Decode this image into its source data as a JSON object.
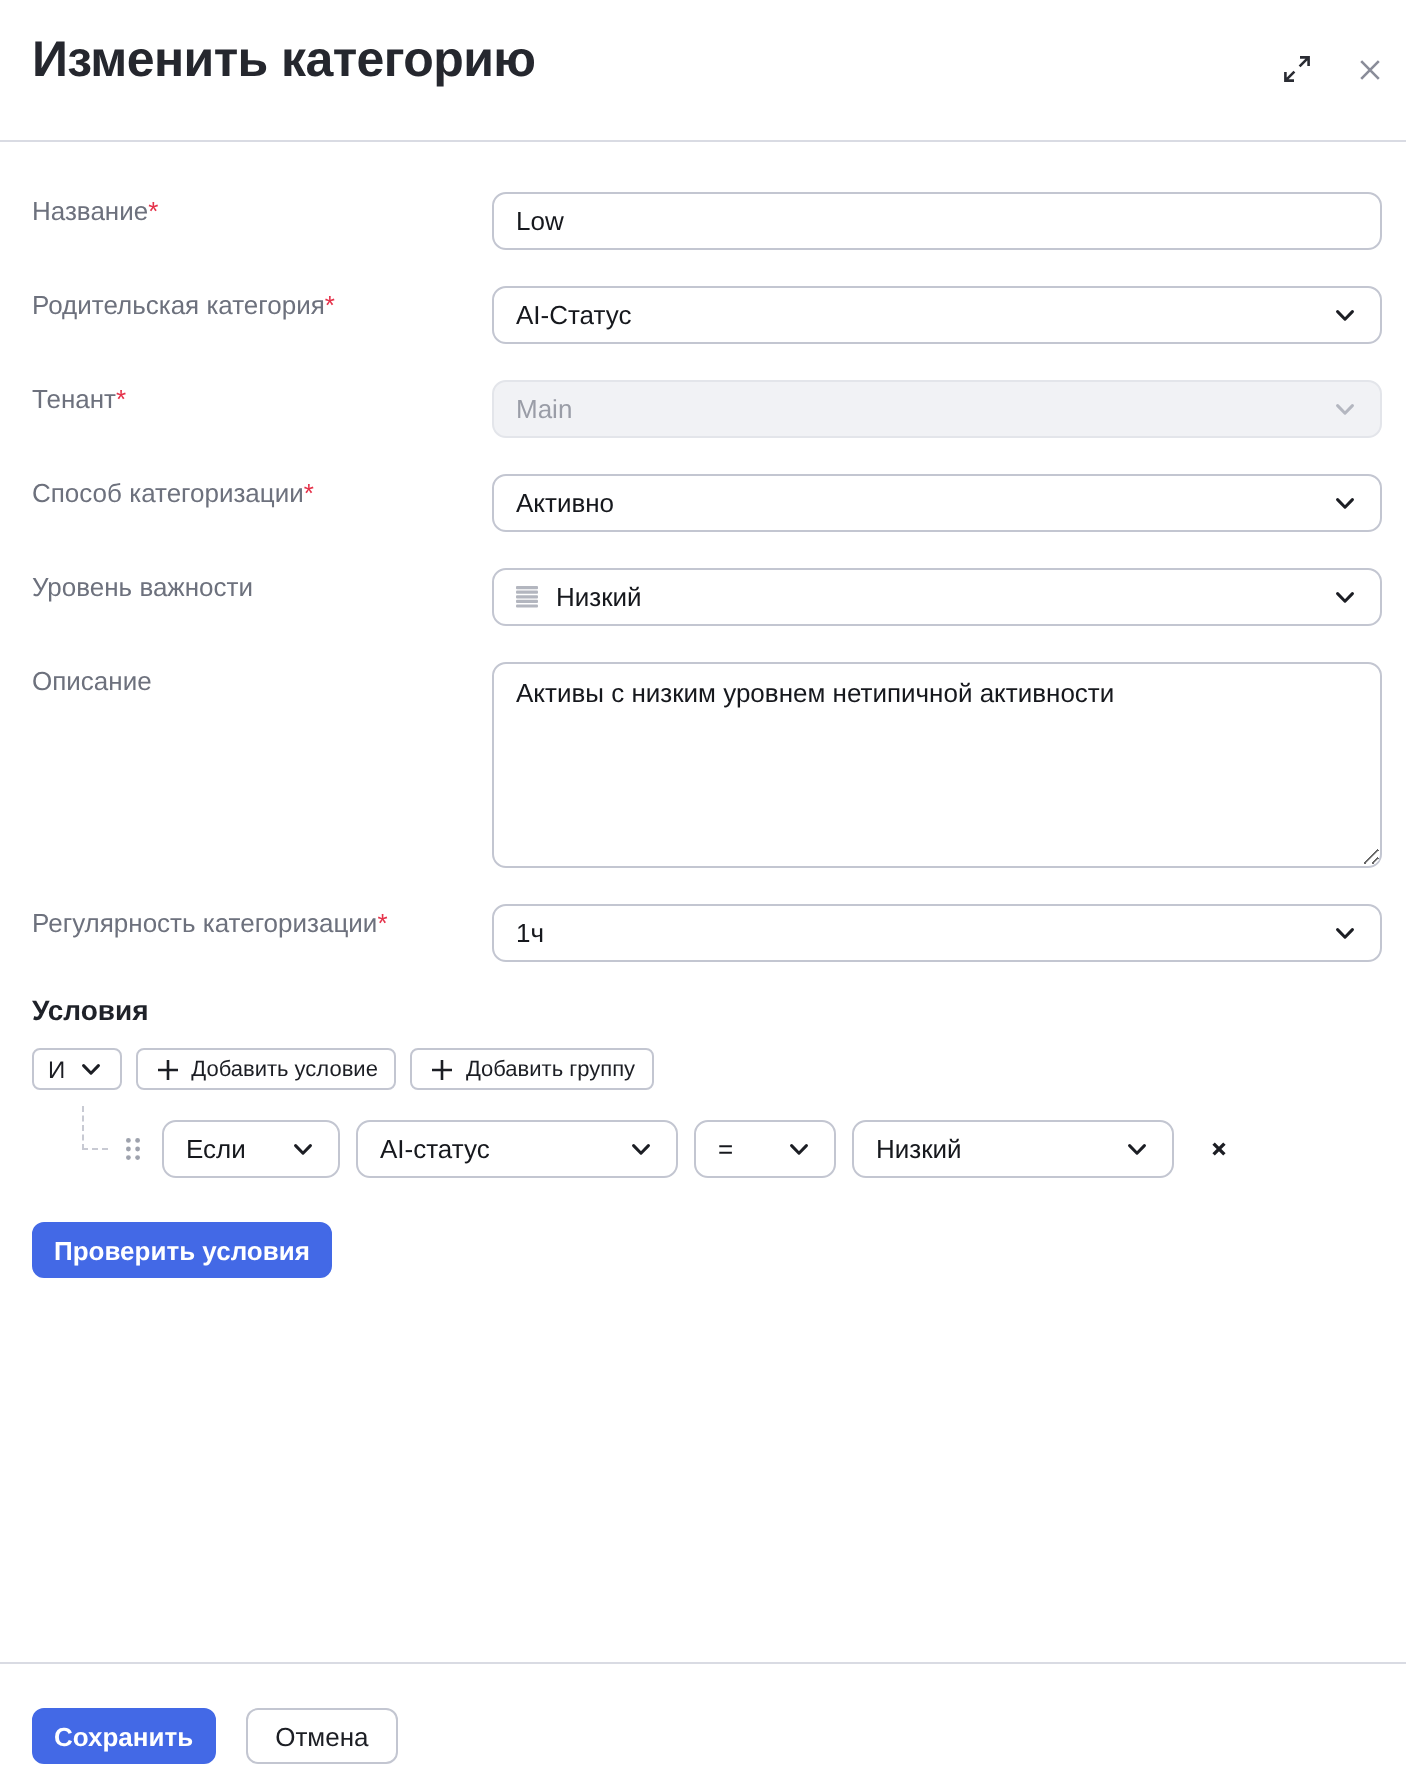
{
  "dialog": {
    "title": "Изменить категорию"
  },
  "fields": [
    {
      "kind": "text",
      "label": "Название",
      "required_mark": "*",
      "value": "Low",
      "disabled": false
    },
    {
      "kind": "select",
      "label": "Родительская категория",
      "required_mark": "*",
      "value": "AI-Статус",
      "disabled": false
    },
    {
      "kind": "select",
      "label": "Тенант",
      "required_mark": "*",
      "value": "Main",
      "disabled": true
    },
    {
      "kind": "select",
      "label": "Способ категоризации",
      "required_mark": "*",
      "value": "Активно",
      "disabled": false
    },
    {
      "kind": "level_select",
      "label": "Уровень важности",
      "value": "Низкий",
      "disabled": false
    },
    {
      "kind": "textarea",
      "label": "Описание",
      "value": "Активы с низким уровнем нетипичной активности",
      "disabled": false
    },
    {
      "kind": "select",
      "label": "Регулярность категоризации",
      "required_mark": "*",
      "value": "1ч",
      "disabled": false
    }
  ],
  "conditions": {
    "title": "Условия",
    "operator": "И",
    "actions": [
      "Добавить условие",
      "Добавить группу"
    ],
    "rules": [
      {
        "parts": [
          "Если",
          "AI-статус",
          "=",
          "Низкий"
        ]
      }
    ],
    "check_button": "Проверить условия"
  },
  "footer": {
    "buttons": [
      {
        "label": "Сохранить",
        "kind": "primary"
      },
      {
        "label": "Отмена",
        "kind": "secondary"
      }
    ]
  }
}
